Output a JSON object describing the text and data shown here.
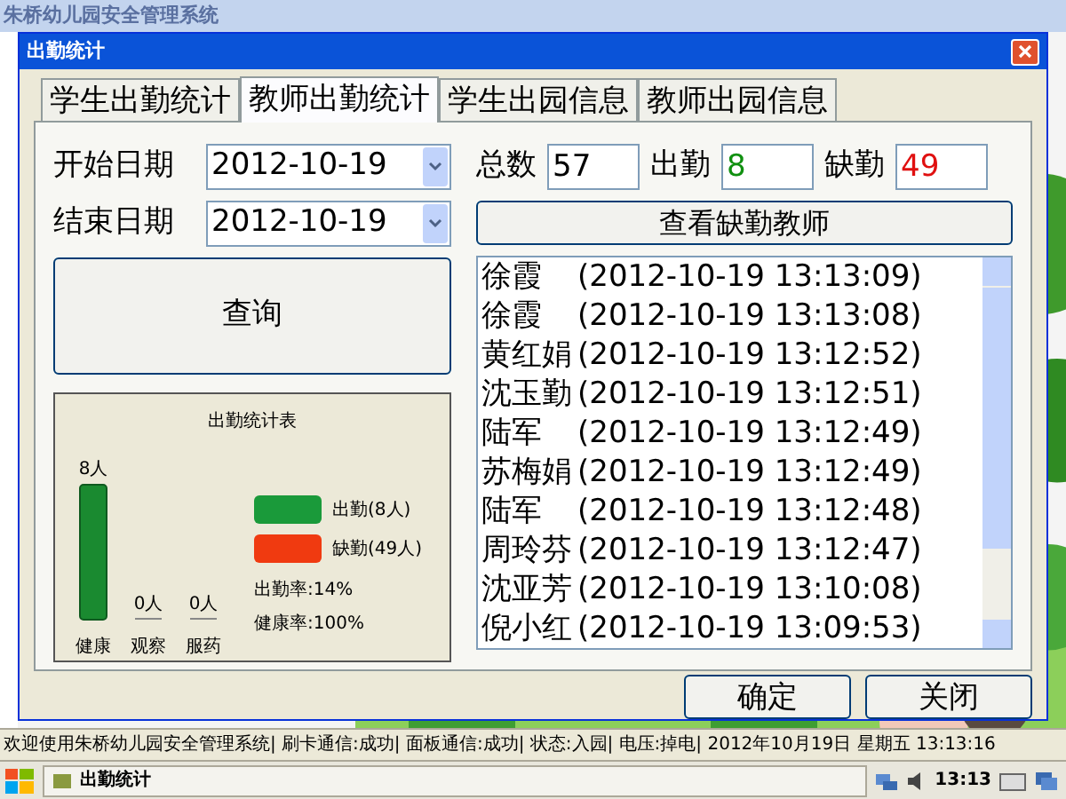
{
  "parent_window": {
    "title": "朱桥幼儿园安全管理系统"
  },
  "dialog": {
    "title": "出勤统计"
  },
  "tabs": [
    {
      "label": "学生出勤统计",
      "selected": false
    },
    {
      "label": "教师出勤统计",
      "selected": true
    },
    {
      "label": "学生出园信息",
      "selected": false
    },
    {
      "label": "教师出园信息",
      "selected": false
    }
  ],
  "start_date": {
    "label": "开始日期",
    "value": "2012-10-19"
  },
  "end_date": {
    "label": "结束日期",
    "value": "2012-10-19"
  },
  "query_button": "查询",
  "chart": {
    "chart_data": {
      "type": "bar",
      "title": "出勤统计表",
      "categories": [
        "健康",
        "观察",
        "服药"
      ],
      "values": [
        8,
        0,
        0
      ],
      "ylim": [
        0,
        8
      ],
      "value_labels": [
        "8人",
        "0人",
        "0人"
      ]
    },
    "legend": [
      {
        "label": "出勤(8人)",
        "color": "#1a9a3a"
      },
      {
        "label": "缺勤(49人)",
        "color": "#f03a10"
      }
    ],
    "rates": [
      "出勤率:14%",
      "健康率:100%"
    ]
  },
  "counts": [
    {
      "label": "总数",
      "value": "57",
      "color": "#000000"
    },
    {
      "label": "出勤",
      "value": "8",
      "color": "#109010"
    },
    {
      "label": "缺勤",
      "value": "49",
      "color": "#e01010"
    }
  ],
  "absent_button": "查看缺勤教师",
  "records": [
    {
      "name": "徐霞",
      "time": "(2012-10-19 13:13:09)"
    },
    {
      "name": "徐霞",
      "time": "(2012-10-19 13:13:08)"
    },
    {
      "name": "黄红娟",
      "time": "(2012-10-19 13:12:52)"
    },
    {
      "name": "沈玉勤",
      "time": "(2012-10-19 13:12:51)"
    },
    {
      "name": "陆军",
      "time": "(2012-10-19 13:12:49)"
    },
    {
      "name": "苏梅娟",
      "time": "(2012-10-19 13:12:49)"
    },
    {
      "name": "陆军",
      "time": "(2012-10-19 13:12:48)"
    },
    {
      "name": "周玲芬",
      "time": "(2012-10-19 13:12:47)"
    },
    {
      "name": "沈亚芳",
      "time": "(2012-10-19 13:10:08)"
    },
    {
      "name": "倪小红",
      "time": "(2012-10-19 13:09:53)"
    }
  ],
  "buttons": [
    "确定",
    "关闭"
  ],
  "status_bar": "欢迎使用朱桥幼儿园安全管理系统| 刷卡通信:成功| 面板通信:成功| 状态:入园| 电压:掉电| 2012年10月19日 星期五 13:13:16",
  "taskbar": {
    "task": "出勤统计",
    "clock": "13:13"
  }
}
